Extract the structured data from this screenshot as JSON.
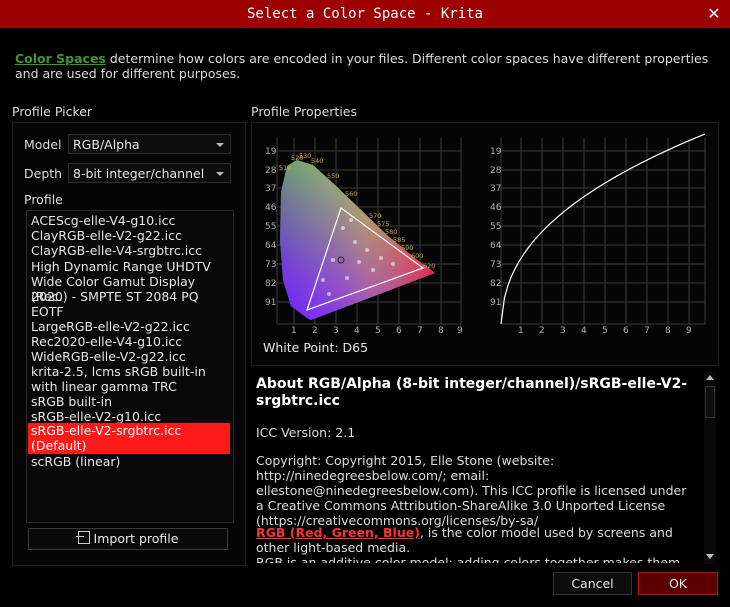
{
  "window": {
    "title": "Select a Color Space - Krita"
  },
  "intro": {
    "link": "Color Spaces",
    "text": " determine how colors are encoded in your files. Different color spaces have different properties and are used for different purposes."
  },
  "picker": {
    "section_label": "Profile Picker",
    "model_label": "Model",
    "model_value": "RGB/Alpha",
    "depth_label": "Depth",
    "depth_value": "8-bit integer/channel",
    "profile_label": "Profile",
    "profiles": [
      "ACEScg-elle-V4-g10.icc",
      "ClayRGB-elle-V2-g22.icc",
      "ClayRGB-elle-V4-srgbtrc.icc",
      "High Dynamic Range UHDTV",
      "Wide Color Gamut Display (Rec.",
      "2020) - SMPTE ST 2084 PQ",
      "EOTF",
      "LargeRGB-elle-V2-g22.icc",
      "Rec2020-elle-V4-g10.icc",
      "WideRGB-elle-V2-g22.icc",
      "krita-2.5, lcms sRGB built-in",
      "with linear gamma TRC",
      "sRGB built-in",
      "sRGB-elle-V2-g10.icc",
      "sRGB-elle-V2-srgbtrc.icc",
      "(Default)",
      "scRGB (linear)"
    ],
    "import_label": "Import profile"
  },
  "properties": {
    "section_label": "Profile Properties",
    "white_point": "White Point:  D65",
    "y_ticks": [
      "19",
      "28",
      "37",
      "46",
      "55",
      "64",
      "73",
      "82",
      "91"
    ],
    "x_ticks": [
      "1",
      "2",
      "3",
      "4",
      "5",
      "6",
      "7",
      "8",
      "9"
    ],
    "locus_labels": [
      "520",
      "530",
      "510",
      "540",
      "550",
      "560",
      "570",
      "575",
      "580",
      "585",
      "590",
      "600",
      "620"
    ],
    "trc_curve_color": "#ffffff"
  },
  "about": {
    "title": "About RGB/Alpha (8-bit integer/channel)/sRGB-elle-V2-srgbtrc.icc",
    "icc_version": "ICC Version: 2.1",
    "copyright": "Copyright: Copyright 2015, Elle Stone (website: http://ninedegreesbelow.com/; email: ellestone@ninedegreesbelow.com). This ICC profile is licensed under a Creative Commons Attribution-ShareAlike 3.0 Unported License (https://creativecommons.org/licenses/by-sa/",
    "model_link": "RGB (Red, Green, Blue)",
    "model_text": ", is the color model used by screens and other light-based media.",
    "model_text2": "RGB is an additive color model: adding colors together makes them"
  },
  "buttons": {
    "cancel": "Cancel",
    "ok": "OK"
  },
  "colors": {
    "title_bar": "#9c0000",
    "selection": "#ff1a1a",
    "link_green": "#3a9a2a",
    "link_red": "#ff3030"
  }
}
